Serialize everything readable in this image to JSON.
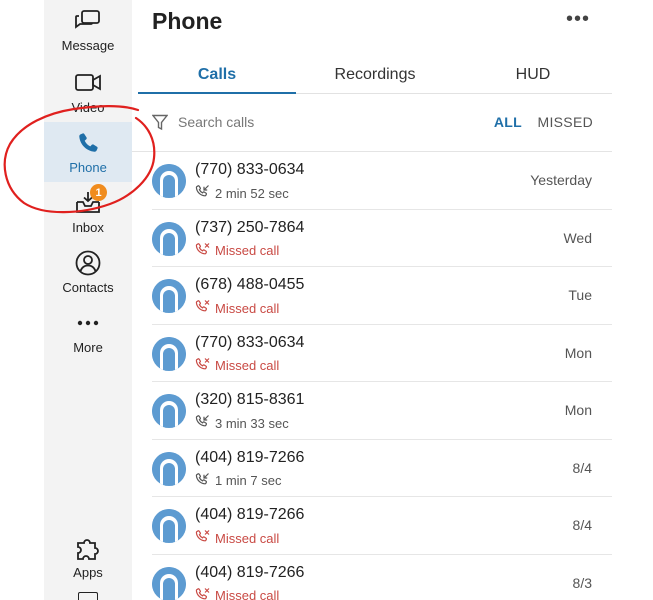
{
  "sidebar": {
    "items": [
      {
        "label": "Message",
        "icon": "message-icon"
      },
      {
        "label": "Video",
        "icon": "video-icon"
      },
      {
        "label": "Phone",
        "icon": "phone-icon",
        "active": true
      },
      {
        "label": "Inbox",
        "icon": "inbox-icon",
        "badge": "1"
      },
      {
        "label": "Contacts",
        "icon": "contacts-icon"
      },
      {
        "label": "More",
        "icon": "more-dots-icon"
      },
      {
        "label": "Apps",
        "icon": "puzzle-icon"
      }
    ]
  },
  "header": {
    "title": "Phone",
    "more_label": "•••"
  },
  "tabs": [
    {
      "label": "Calls",
      "active": true
    },
    {
      "label": "Recordings"
    },
    {
      "label": "HUD"
    }
  ],
  "filter": {
    "placeholder": "Search calls",
    "all_label": "ALL",
    "missed_label": "MISSED"
  },
  "calls": [
    {
      "number": "(770) 833-0634",
      "detail": "2 min 52 sec",
      "missed": false,
      "date": "Yesterday"
    },
    {
      "number": "(737) 250-7864",
      "detail": "Missed call",
      "missed": true,
      "date": "Wed"
    },
    {
      "number": "(678) 488-0455",
      "detail": "Missed call",
      "missed": true,
      "date": "Tue"
    },
    {
      "number": "(770) 833-0634",
      "detail": "Missed call",
      "missed": true,
      "date": "Mon"
    },
    {
      "number": "(320) 815-8361",
      "detail": "3 min 33 sec",
      "missed": false,
      "date": "Mon"
    },
    {
      "number": "(404) 819-7266",
      "detail": "1 min 7 sec",
      "missed": false,
      "date": "8/4"
    },
    {
      "number": "(404) 819-7266",
      "detail": "Missed call",
      "missed": true,
      "date": "8/4"
    },
    {
      "number": "(404) 819-7266",
      "detail": "Missed call",
      "missed": true,
      "date": "8/3"
    }
  ],
  "colors": {
    "accent": "#1f6fa8",
    "missed": "#c94a44",
    "badge": "#f08c1e",
    "avatar": "#5d9bd1",
    "annotation": "#e0201e"
  }
}
